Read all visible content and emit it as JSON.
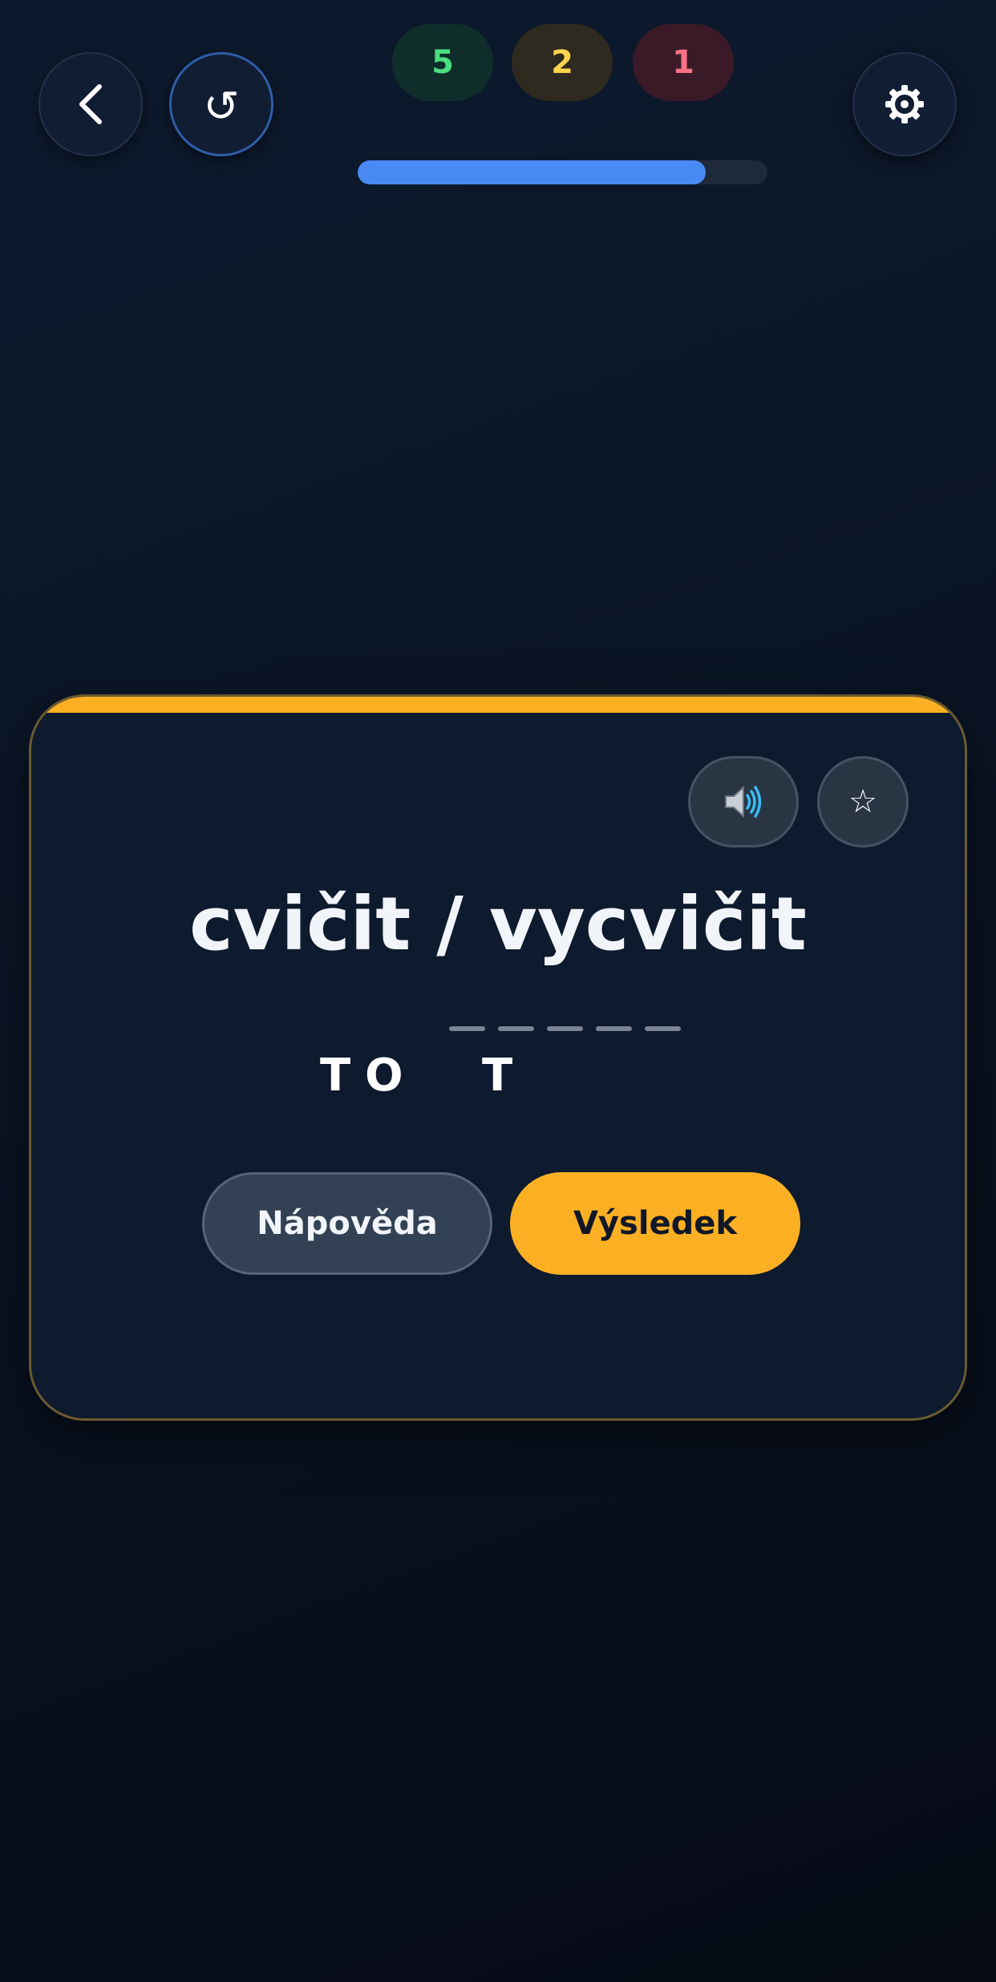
{
  "header": {
    "back_icon": "chevron-left-icon",
    "reset_icon": "rotate-ccw-icon",
    "reset_glyph": "↺",
    "settings_icon": "gear-icon",
    "scores": [
      {
        "value": "5",
        "color": "#4ade80"
      },
      {
        "value": "2",
        "color": "#fcd34d"
      },
      {
        "value": "1",
        "color": "#fb7185"
      }
    ],
    "progress_percent": 85,
    "progress_color": "#4a8af4"
  },
  "card": {
    "accent_color": "#fbb024",
    "sound_icon": "speaker-icon",
    "favorite_icon": "star-icon",
    "favorite_glyph": "☆",
    "word": "cvičit / vycvičit",
    "blank_count": 5,
    "answer_letters": [
      "T",
      "O",
      "T"
    ],
    "hint_label": "Nápověda",
    "result_label": "Výsledek"
  }
}
